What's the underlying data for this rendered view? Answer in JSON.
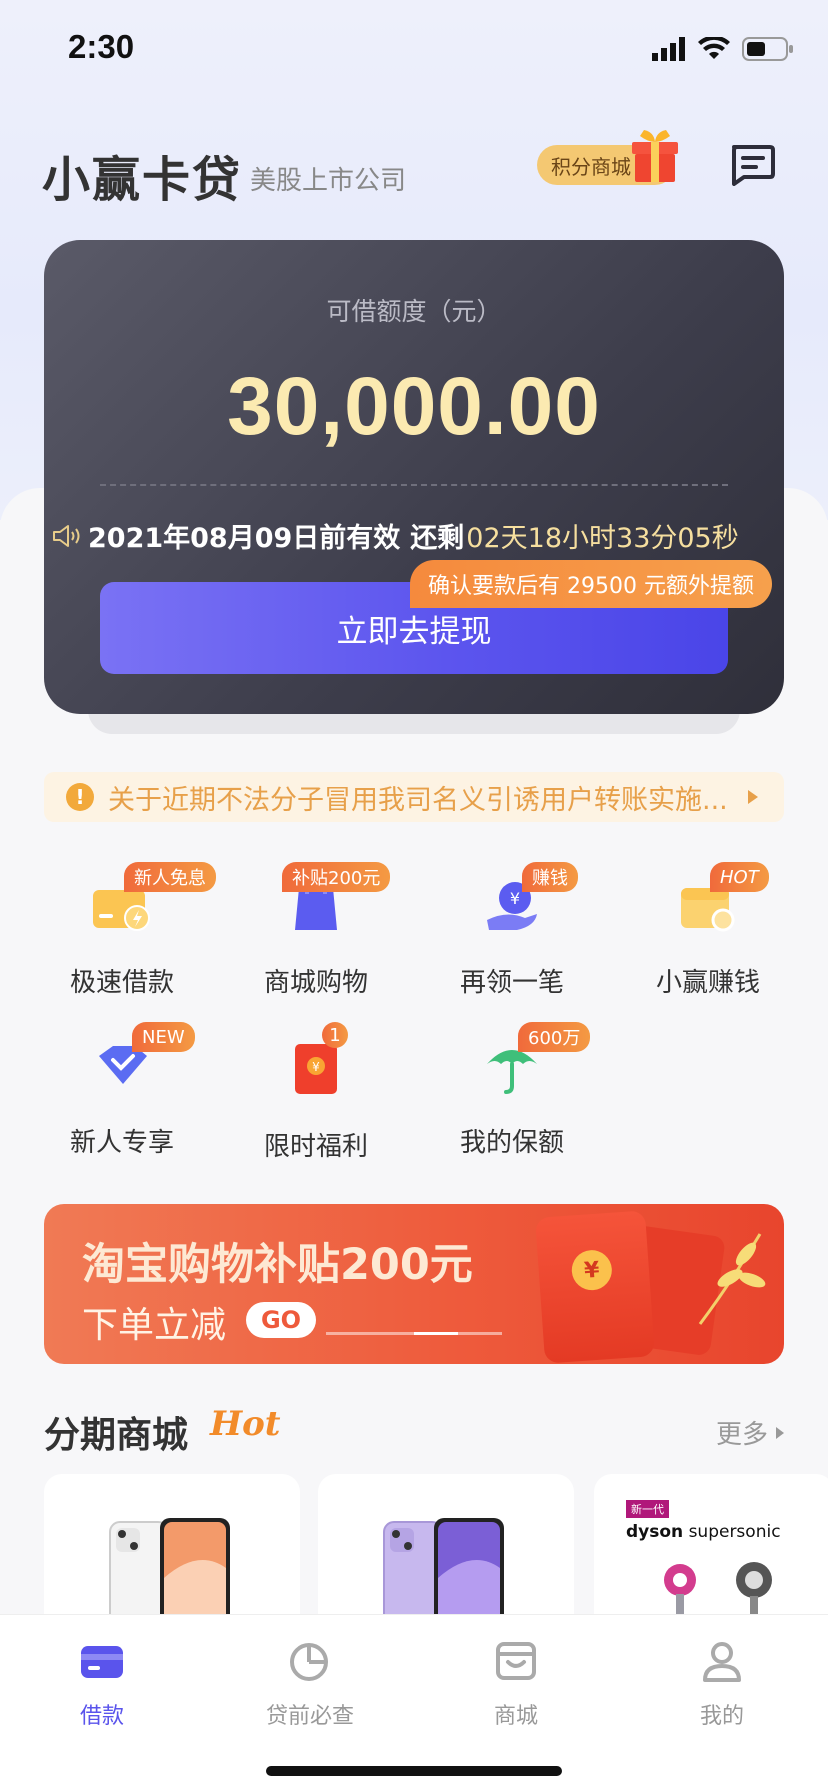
{
  "status_bar": {
    "time": "2:30"
  },
  "header": {
    "title": "小赢卡贷",
    "subtitle": "美股上市公司",
    "points_mall": "积分商城"
  },
  "credit_card": {
    "label": "可借额度（元）",
    "amount": "30,000.00",
    "valid_date": "2021年08月09日前有效",
    "remain_label": "还剩",
    "countdown": "02天18小时33分05秒",
    "extra_tip": "确认要款后有 29500 元额外提额",
    "withdraw_button": "立即去提现"
  },
  "notice": {
    "text": "关于近期不法分子冒用我司名义引诱用户转账实施..."
  },
  "grid": [
    {
      "label": "极速借款",
      "badge": "新人免息",
      "icon": "card-lightning-icon"
    },
    {
      "label": "商城购物",
      "badge": "补贴200元",
      "icon": "shopping-bag-icon"
    },
    {
      "label": "再领一笔",
      "badge": "赚钱",
      "icon": "hand-yen-icon"
    },
    {
      "label": "小赢赚钱",
      "badge": "HOT",
      "icon": "wallet-coin-icon"
    },
    {
      "label": "新人专享",
      "badge": "NEW",
      "icon": "diamond-check-icon"
    },
    {
      "label": "限时福利",
      "badge": "1",
      "icon": "red-envelope-icon"
    },
    {
      "label": "我的保额",
      "badge": "600万",
      "icon": "umbrella-icon"
    }
  ],
  "banner": {
    "title": "淘宝购物补贴200元",
    "subtitle": "下单立减",
    "go": "GO"
  },
  "mall": {
    "title": "分期商城",
    "hot": "Hot",
    "more": "更多",
    "products": [
      {
        "name": "iPhone 12 white",
        "icon": "phone-white-icon"
      },
      {
        "name": "iPhone 12 purple",
        "icon": "phone-purple-icon"
      },
      {
        "tag": "新一代",
        "brand": "dyson",
        "model": "supersonic",
        "icon": "hair-dryer-icon"
      }
    ]
  },
  "tabbar": [
    {
      "label": "借款",
      "icon": "card-icon",
      "active": true
    },
    {
      "label": "贷前必查",
      "icon": "pie-chart-icon",
      "active": false
    },
    {
      "label": "商城",
      "icon": "store-icon",
      "active": false
    },
    {
      "label": "我的",
      "icon": "person-icon",
      "active": false
    }
  ],
  "colors": {
    "accent": "#5a54ec",
    "gold": "#fbeab1",
    "orange": "#f28b2a",
    "banner": "#ee5b3c"
  }
}
